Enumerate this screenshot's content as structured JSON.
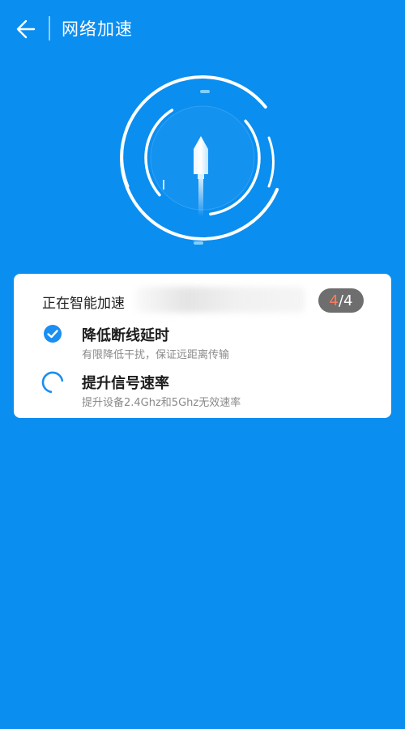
{
  "header": {
    "title": "网络加速"
  },
  "status": {
    "text": "正在智能加速",
    "step_current": "4",
    "step_sep": "/",
    "step_total": "4"
  },
  "steps": [
    {
      "title": "降低断线延时",
      "desc": "有限降低干扰，保证远距离传输",
      "state": "done"
    },
    {
      "title": "提升信号速率",
      "desc": "提升设备2.4Ghz和5Ghz无效速率",
      "state": "loading"
    }
  ],
  "colors": {
    "background": "#0a8ef0",
    "accent": "#1a8ef2",
    "badge_bg": "#6e6e6e",
    "badge_current": "#ff7a5c"
  }
}
